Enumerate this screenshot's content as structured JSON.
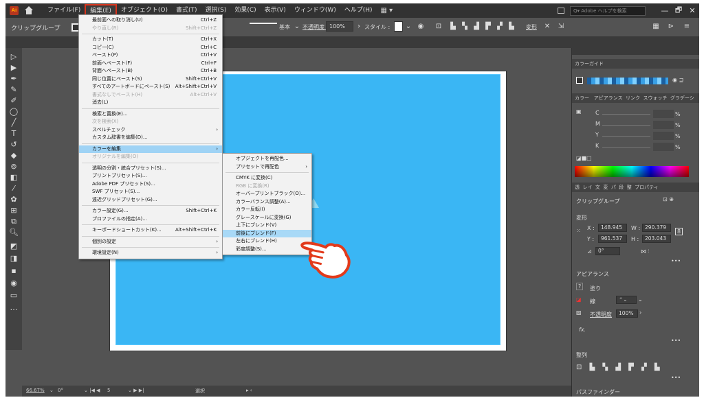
{
  "menubar": {
    "logo": "Ai",
    "items": [
      "ファイル(F)",
      "編集(E)",
      "オブジェクト(O)",
      "書式(T)",
      "選択(S)",
      "効果(C)",
      "表示(V)",
      "ウィンドウ(W)",
      "ヘルプ(H)"
    ],
    "workspace_icon": "▦ ▾",
    "help_search": "Q▾ Adobe ヘルプを検索",
    "window_controls": [
      "—",
      "🗗",
      "✕"
    ]
  },
  "control_bar": {
    "selection_label": "クリップグループ",
    "stroke_profile": "基本",
    "opacity_label": "不透明度 :",
    "opacity_value": "100%",
    "style_label": "スタイル :",
    "transform_label": "変形"
  },
  "edit_menu": [
    {
      "label": "最前面への取り消し(U)",
      "shortcut": "Ctrl+Z"
    },
    {
      "label": "やり直し(R)",
      "shortcut": "Shift+Ctrl+Z",
      "disabled": true
    },
    {
      "sep": true
    },
    {
      "label": "カット(T)",
      "shortcut": "Ctrl+X"
    },
    {
      "label": "コピー(C)",
      "shortcut": "Ctrl+C"
    },
    {
      "label": "ペースト(P)",
      "shortcut": "Ctrl+V"
    },
    {
      "label": "前面へペースト(F)",
      "shortcut": "Ctrl+F"
    },
    {
      "label": "背面へペースト(B)",
      "shortcut": "Ctrl+B"
    },
    {
      "label": "同じ位置にペースト(S)",
      "shortcut": "Shift+Ctrl+V"
    },
    {
      "label": "すべてのアートボードにペースト(S)",
      "shortcut": "Alt+Shift+Ctrl+V"
    },
    {
      "label": "書式なしでペースト(H)",
      "shortcut": "Alt+Ctrl+V",
      "disabled": true
    },
    {
      "label": "消去(L)",
      "shortcut": ""
    },
    {
      "sep": true
    },
    {
      "label": "検索と置換(E)...",
      "shortcut": ""
    },
    {
      "label": "次を検索(X)",
      "shortcut": "",
      "disabled": true
    },
    {
      "label": "スペルチェック",
      "shortcut": "",
      "submenu": true
    },
    {
      "label": "カスタム辞書を編集(D)...",
      "shortcut": ""
    },
    {
      "sep": true
    },
    {
      "label": "カラーを編集",
      "shortcut": "",
      "submenu": true,
      "highlight": true
    },
    {
      "label": "オリジナルを編集(O)",
      "shortcut": "",
      "disabled": true
    },
    {
      "sep": true
    },
    {
      "label": "透明の分割・統合プリセット(S)...",
      "shortcut": ""
    },
    {
      "label": "プリントプリセット(S)...",
      "shortcut": ""
    },
    {
      "label": "Adobe PDF プリセット(S)...",
      "shortcut": ""
    },
    {
      "label": "SWF プリセット(S)...",
      "shortcut": ""
    },
    {
      "label": "遠近グリッドプリセット(G)...",
      "shortcut": ""
    },
    {
      "sep": true
    },
    {
      "label": "カラー設定(G)...",
      "shortcut": "Shift+Ctrl+K"
    },
    {
      "label": "プロファイルの指定(A)...",
      "shortcut": ""
    },
    {
      "sep": true
    },
    {
      "label": "キーボードショートカット(K)...",
      "shortcut": "Alt+Shift+Ctrl+K"
    },
    {
      "sep": true
    },
    {
      "label": "個別の設定",
      "shortcut": "",
      "submenu": true
    },
    {
      "sep": true
    },
    {
      "label": "環境設定(N)",
      "shortcut": "",
      "submenu": true
    }
  ],
  "color_submenu": [
    {
      "label": "オブジェクトを再配色..."
    },
    {
      "label": "プリセットで再配色",
      "submenu": true
    },
    {
      "sep": true
    },
    {
      "label": "CMYK に変換(C)"
    },
    {
      "label": "RGB に変換(R)",
      "disabled": true
    },
    {
      "label": "オーバープリントブラック(O)..."
    },
    {
      "label": "カラーバランス調整(A)..."
    },
    {
      "label": "カラー反転(I)"
    },
    {
      "label": "グレースケールに変換(G)"
    },
    {
      "label": "上下にブレンド(V)"
    },
    {
      "label": "前後にブレンド(F)",
      "highlight": true
    },
    {
      "label": "左右にブレンド(H)"
    },
    {
      "label": "彩度調整(S)..."
    }
  ],
  "right_panel": {
    "color_guide_title": "カラーガイド",
    "tabs1": [
      "カラー",
      "アピアランス",
      "リンク",
      "スウォッチ",
      "グラデーシ"
    ],
    "cmyk": [
      "C",
      "M",
      "Y",
      "K"
    ],
    "pct": "%",
    "tabs2": [
      "透",
      "レイ",
      "文",
      "変",
      "パ",
      "段",
      "整",
      "プロパティ"
    ],
    "group_label": "クリップグループ",
    "transform_title": "変形",
    "x_label": "X :",
    "x_value": "148.945",
    "w_label": "W :",
    "w_value": "290.379",
    "y_label": "Y :",
    "y_value": "961.537",
    "h_label": "H :",
    "h_value": "203.043",
    "angle_label": "⊿",
    "angle_value": "0°",
    "appearance_title": "アピアランス",
    "fill_label": "塗り",
    "stroke_label": "線",
    "opacity_label": "不透明度",
    "opacity_value": "100%",
    "fx_label": "fx.",
    "align_title": "整列",
    "pathfinder_title": "パスファインダー"
  },
  "status_bar": {
    "zoom": "66.67%",
    "rotation": "0°",
    "artboard": "5",
    "mode": "選択"
  }
}
